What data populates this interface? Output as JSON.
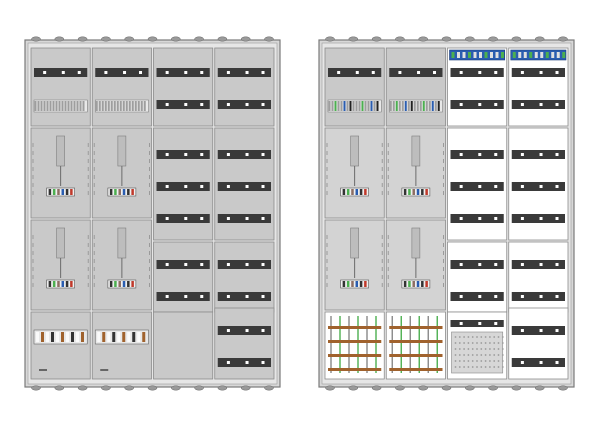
{
  "illustration": {
    "subject": "meter-cabinet",
    "views": [
      {
        "id": "closed",
        "columns": 4,
        "sections": [
          "terminal-rail-row",
          "meter-row-1",
          "meter-row-2",
          "distribution-row"
        ]
      },
      {
        "id": "open",
        "columns": 4,
        "sections": [
          "terminal-rail-row",
          "meter-row-1",
          "meter-row-2",
          "distribution-row"
        ]
      }
    ]
  },
  "colors": {
    "frame": "#8c8c8c",
    "panel": "#c9c9c9",
    "panel_dark": "#b4b4b4",
    "rail": "#3a3a3a",
    "terminal_green": "#4caf50",
    "terminal_brown": "#a0622d",
    "terminal_blue": "#2a5db0",
    "terminal_red": "#c0392b",
    "background": "#ffffff"
  }
}
